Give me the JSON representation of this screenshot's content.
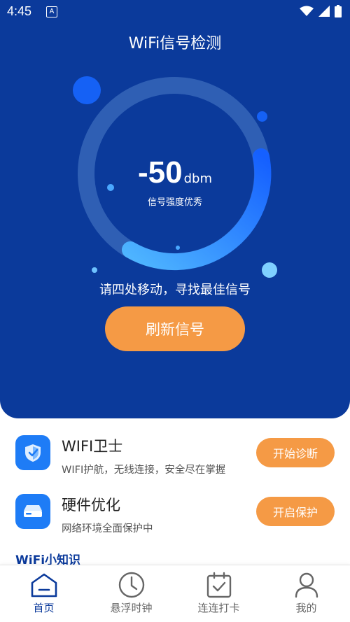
{
  "status_bar": {
    "time": "4:45",
    "indicator_letter": "A"
  },
  "header": {
    "title": "WiFi信号检测"
  },
  "signal": {
    "value": "-50",
    "unit": "dbm",
    "quality": "信号强度优秀"
  },
  "tip": "请四处移动，寻找最佳信号",
  "refresh_button": "刷新信号",
  "features": [
    {
      "title": "WIFI卫士",
      "description": "WIFI护航，无线连接，安全尽在掌握",
      "button": "开始诊断",
      "icon": "shield-icon"
    },
    {
      "title": "硬件优化",
      "description": "网络环境全面保护中",
      "button": "开启保护",
      "icon": "router-icon"
    }
  ],
  "tips_heading": "WiFi小知识",
  "tabs": [
    {
      "label": "首页",
      "icon": "home-icon",
      "active": true
    },
    {
      "label": "悬浮时钟",
      "icon": "clock-icon",
      "active": false
    },
    {
      "label": "连连打卡",
      "icon": "calendar-check-icon",
      "active": false
    },
    {
      "label": "我的",
      "icon": "user-icon",
      "active": false
    }
  ],
  "colors": {
    "primary": "#0b3a9b",
    "accent": "#f59a45",
    "icon_blue": "#1e7cf6"
  }
}
